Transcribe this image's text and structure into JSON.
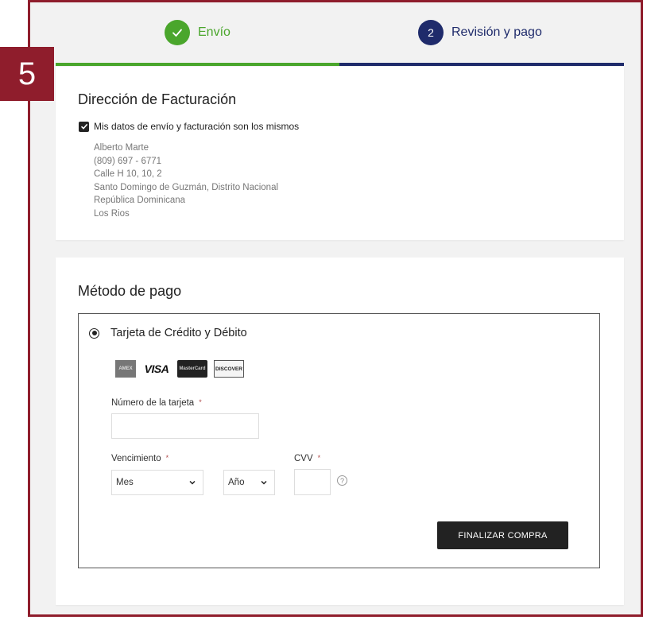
{
  "badge": {
    "number": "5"
  },
  "stepper": {
    "step1": {
      "label": "Envío"
    },
    "step2": {
      "number": "2",
      "label": "Revisión y pago"
    }
  },
  "billing": {
    "title": "Dirección de Facturación",
    "same_as_shipping": "Mis datos de envío y facturación son los mismos",
    "address": [
      "Alberto Marte",
      "(809) 697 - 6771",
      "Calle H 10, 10, 2",
      "Santo Domingo de Guzmán, Distrito Nacional",
      "República Dominicana",
      "Los Rios"
    ]
  },
  "payment": {
    "title": "Método de pago",
    "option_label": "Tarjeta de Crédito y Débito",
    "logos": {
      "amex": "AMEX",
      "visa": "VISA",
      "mastercard": "MasterCard",
      "discover": "DISCOVER"
    },
    "card_number_label": "Número de la tarjeta",
    "expiry_label": "Vencimiento",
    "cvv_label": "CVV",
    "required_mark": "*",
    "month_value": "Mes",
    "year_value": "Año",
    "help_glyph": "?",
    "submit_label": "FINALIZAR COMPRA"
  }
}
